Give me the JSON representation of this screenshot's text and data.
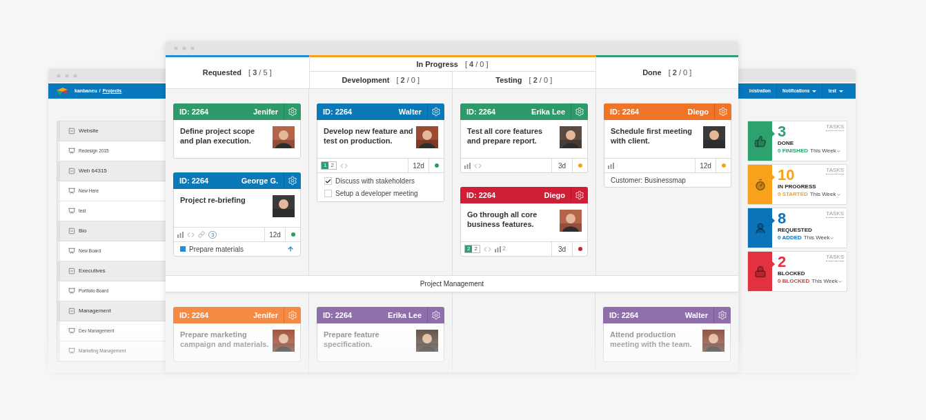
{
  "back_window": {
    "breadcrumb": {
      "org": "kanbaneu",
      "separator": "/",
      "link": "Projects"
    },
    "nav_items": [
      {
        "label": "inistration",
        "dropdown": false
      },
      {
        "label": "Notifications",
        "dropdown": true
      },
      {
        "label": "test",
        "dropdown": true
      }
    ],
    "projects": [
      {
        "label": "Website",
        "expanded": true,
        "children": [
          {
            "label": "Redesign 2015"
          }
        ]
      },
      {
        "label": "Web 64315",
        "expanded": true,
        "children": [
          {
            "label": "New Here"
          },
          {
            "label": "test"
          }
        ]
      },
      {
        "label": "Bio",
        "expanded": true,
        "children": [
          {
            "label": "New Board"
          }
        ]
      },
      {
        "label": "Executives",
        "expanded": true,
        "children": [
          {
            "label": "Portfolio Board"
          }
        ]
      },
      {
        "label": "Management",
        "expanded": true,
        "children": [
          {
            "label": "Dev Management"
          },
          {
            "label": "Marketing Management"
          }
        ]
      }
    ],
    "stats": [
      {
        "kind": "thumb",
        "color": "#2ea26e",
        "number": "3",
        "label": "DONE",
        "delta": "0 FINISHED",
        "period": "This Week",
        "tag": "TASKS"
      },
      {
        "kind": "timer",
        "color": "#f8a11a",
        "number": "10",
        "label": "IN PROGRESS",
        "delta": "0 STARTED",
        "period": "This Week",
        "tag": "TASKS"
      },
      {
        "kind": "person",
        "color": "#0b74b8",
        "number": "8",
        "label": "REQUESTED",
        "delta": "0 ADDED",
        "period": "This Week",
        "tag": "TASKS"
      },
      {
        "kind": "lock",
        "color": "#e2313f",
        "number": "2",
        "label": "BLOCKED",
        "delta": "0 BLOCKED",
        "period": "This Week",
        "tag": "TASKS"
      }
    ]
  },
  "board": {
    "columns": [
      {
        "title": "Requested",
        "count": "[ **3** / 5 ]",
        "color": "#1e90d2"
      },
      {
        "title": "In Progress",
        "count": "[ **4** / 0 ]",
        "color": "#f5a01a",
        "children": [
          {
            "title": "Development",
            "count": "[ **2** / 0 ]"
          },
          {
            "title": "Testing",
            "count": "[ **2** / 0 ]"
          }
        ]
      },
      {
        "title": "Done",
        "count": "[ **2** / 0 ]",
        "color": "#2e9e72"
      }
    ],
    "lanes": [
      {
        "cells": [
          {
            "cards": [
              {
                "id": "ID: 2264",
                "owner": "Jenifer",
                "color": "#2e9a6a",
                "title": "Define project scope and plan execution."
              },
              {
                "id": "ID: 2264",
                "owner": "George G.",
                "color": "#0b78b8",
                "title": "Project re-briefing",
                "footer": {
                  "icons": [
                    {
                      "kind": "bars"
                    },
                    {
                      "kind": "code"
                    },
                    {
                      "kind": "link"
                    },
                    {
                      "kind": "comments",
                      "count": "3"
                    }
                  ],
                  "days": "12d",
                  "status": {
                    "color": "#2e9e5e"
                  }
                },
                "links": [
                  {
                    "label": "Prepare materials",
                    "color": "#1e90d2"
                  }
                ]
              }
            ]
          },
          {
            "cards": [
              {
                "id": "ID: 2264",
                "owner": "Walter",
                "color": "#0b78b8",
                "title": "Develop new feature and test on production.",
                "footer": {
                  "counter": {
                    "done": "1",
                    "total": "2"
                  },
                  "icons": [
                    {
                      "kind": "code"
                    }
                  ],
                  "days": "12d",
                  "status": {
                    "color": "#2e9e5e"
                  }
                },
                "subtasks": [
                  {
                    "label": "Discuss with stakeholders",
                    "checked": true
                  },
                  {
                    "label": "Setup a developer meeting",
                    "checked": false
                  }
                ]
              }
            ]
          },
          {
            "cards": [
              {
                "id": "ID: 2264",
                "owner": "Erika Lee",
                "color": "#2e9a6a",
                "title": "Test all core features and prepare report.",
                "footer": {
                  "icons": [
                    {
                      "kind": "bars"
                    },
                    {
                      "kind": "code"
                    }
                  ],
                  "days": "3d",
                  "status": {
                    "color": "#f7a21b"
                  }
                }
              },
              {
                "id": "ID: 2264",
                "owner": "Diego",
                "color": "#cf1f36",
                "title": "Go through all core business features.",
                "footer": {
                  "counter": {
                    "done": "2",
                    "total": "2"
                  },
                  "icons": [
                    {
                      "kind": "code"
                    },
                    {
                      "kind": "bars",
                      "count": "2"
                    }
                  ],
                  "days": "3d",
                  "status": {
                    "color": "#cf1f36"
                  }
                }
              }
            ]
          },
          {
            "cards": [
              {
                "id": "ID: 2264",
                "owner": "Diego",
                "color": "#f07428",
                "title": "Schedule first meeting with client.",
                "footer": {
                  "icons": [
                    {
                      "kind": "bars"
                    }
                  ],
                  "days": "12d",
                  "status": {
                    "color": "#f7a21b"
                  }
                },
                "custom_field": "Customer: Businessmap"
              }
            ]
          }
        ]
      },
      {
        "title": "Project Management",
        "cells": [
          {
            "cards": [
              {
                "id": "ID: 2264",
                "owner": "Jenifer",
                "color": "#f58a45",
                "title": "Prepare marketing campaign and materials."
              }
            ]
          },
          {
            "cards": [
              {
                "id": "ID: 2264",
                "owner": "Erika Lee",
                "color": "#8e6fac",
                "title": "Prepare feature specification."
              }
            ]
          },
          {},
          {
            "cards": [
              {
                "id": "ID: 2264",
                "owner": "Walter",
                "color": "#8e6fac",
                "title": "Attend production meeting with the team."
              }
            ]
          }
        ]
      }
    ]
  }
}
